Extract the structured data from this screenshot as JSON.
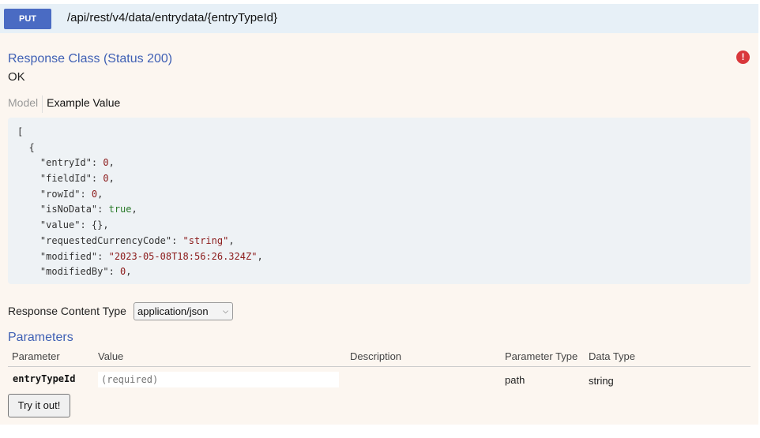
{
  "operation": {
    "method": "PUT",
    "path": "/api/rest/v4/data/entrydata/{entryTypeId}"
  },
  "response_class": {
    "title": "Response Class (Status 200)",
    "status_text": "OK",
    "alert_icon": "exclamation-circle-icon"
  },
  "tabs": {
    "model": "Model",
    "example": "Example Value"
  },
  "example_code": [
    "[",
    "  {",
    "    \"entryId\": 0,",
    "    \"fieldId\": 0,",
    "    \"rowId\": 0,",
    "    \"isNoData\": true,",
    "    \"value\": {},",
    "    \"requestedCurrencyCode\": \"string\",",
    "    \"modified\": \"2023-05-08T18:56:26.324Z\",",
    "    \"modifiedBy\": 0,"
  ],
  "content_type": {
    "label": "Response Content Type",
    "selected": "application/json"
  },
  "parameters": {
    "title": "Parameters",
    "headers": [
      "Parameter",
      "Value",
      "Description",
      "Parameter Type",
      "Data Type"
    ],
    "rows": [
      {
        "name": "entryTypeId",
        "placeholder": "(required)",
        "description": "",
        "param_type": "path",
        "data_type": "string"
      }
    ]
  },
  "try_button": "Try it out!",
  "colors": {
    "method_bg": "#4a6bc3",
    "heading": "#3e5fb4",
    "body_bg": "#fcf6f0",
    "alert": "#d9373b"
  }
}
